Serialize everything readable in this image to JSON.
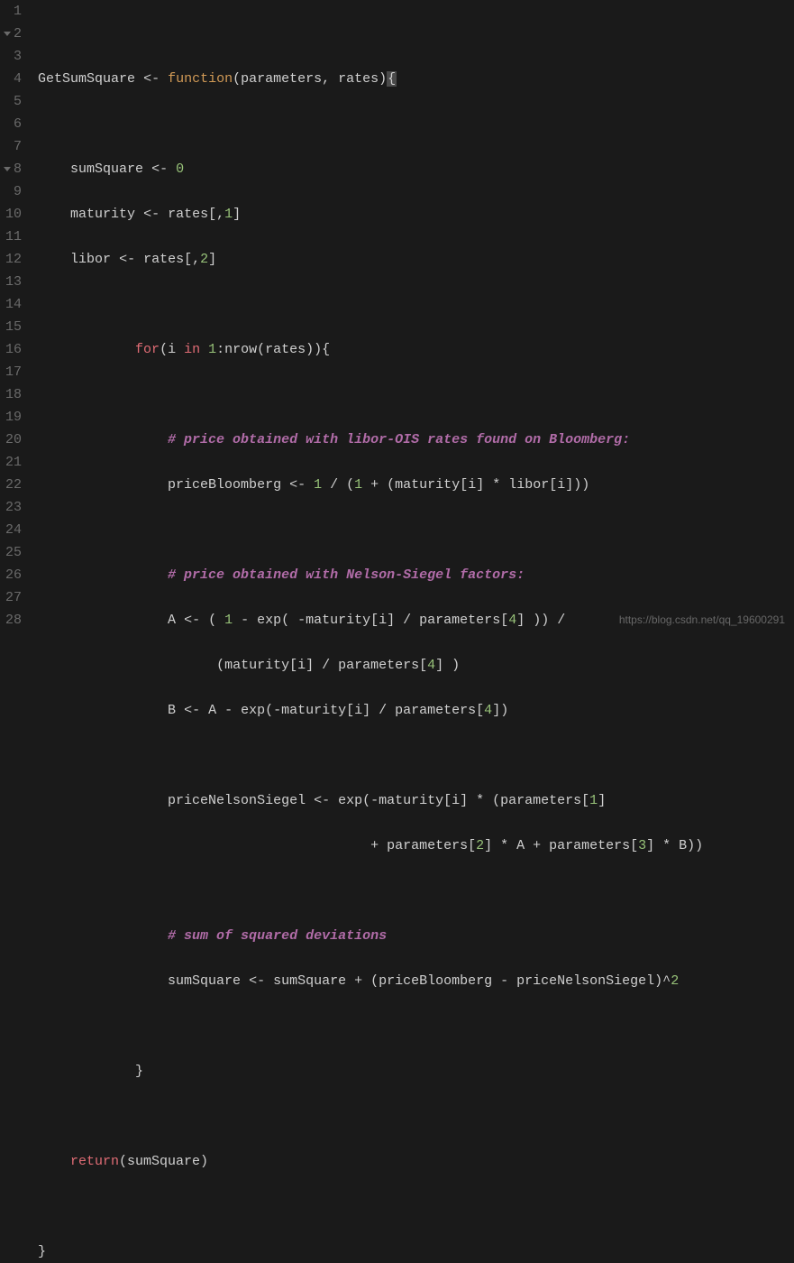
{
  "editor": {
    "watermark": "https://blog.csdn.net/qq_19600291",
    "lines": [
      {
        "num": "1",
        "fold": false
      },
      {
        "num": "2",
        "fold": true
      },
      {
        "num": "3",
        "fold": false
      },
      {
        "num": "4",
        "fold": false
      },
      {
        "num": "5",
        "fold": false
      },
      {
        "num": "6",
        "fold": false
      },
      {
        "num": "7",
        "fold": false
      },
      {
        "num": "8",
        "fold": true
      },
      {
        "num": "9",
        "fold": false
      },
      {
        "num": "10",
        "fold": false
      },
      {
        "num": "11",
        "fold": false
      },
      {
        "num": "12",
        "fold": false
      },
      {
        "num": "13",
        "fold": false
      },
      {
        "num": "14",
        "fold": false
      },
      {
        "num": "15",
        "fold": false
      },
      {
        "num": "16",
        "fold": false
      },
      {
        "num": "17",
        "fold": false
      },
      {
        "num": "18",
        "fold": false
      },
      {
        "num": "19",
        "fold": false
      },
      {
        "num": "20",
        "fold": false
      },
      {
        "num": "21",
        "fold": false
      },
      {
        "num": "22",
        "fold": false
      },
      {
        "num": "23",
        "fold": false
      },
      {
        "num": "24",
        "fold": false
      },
      {
        "num": "25",
        "fold": false
      },
      {
        "num": "26",
        "fold": false
      },
      {
        "num": "27",
        "fold": false
      },
      {
        "num": "28",
        "fold": false
      }
    ],
    "code": {
      "l1": "",
      "l2": {
        "name": "GetSumSquare",
        "assign": "<-",
        "fn": "function",
        "params": "(parameters, rates)",
        "brace": "{"
      },
      "l3": "",
      "l4": {
        "var": "sumSquare",
        "assign": "<-",
        "val": "0"
      },
      "l5": {
        "var": "maturity",
        "assign": "<-",
        "expr1": "rates[,",
        "num": "1",
        "expr2": "]"
      },
      "l6": {
        "var": "libor",
        "assign": "<-",
        "expr1": "rates[,",
        "num": "2",
        "expr2": "]"
      },
      "l7": "",
      "l8": {
        "kw": "for",
        "p1": "(i ",
        "in": "in",
        "sp": " ",
        "num": "1",
        "p2": ":nrow(rates)){"
      },
      "l9": "",
      "l10": {
        "comment": "# price obtained with libor-OIS rates found on Bloomberg:"
      },
      "l11": {
        "var": "priceBloomberg",
        "assign": "<-",
        "n1": "1",
        "t1": " / (",
        "n2": "1",
        "t2": " + (maturity[i] * libor[i]))"
      },
      "l12": "",
      "l13": {
        "comment": "# price obtained with Nelson-Siegel factors:"
      },
      "l14": {
        "var": "A",
        "assign": "<-",
        "t1": "( ",
        "n1": "1",
        "t2": " - exp( -maturity[i] / parameters[",
        "n2": "4",
        "t3": "] )) /"
      },
      "l15": {
        "t1": "(maturity[i] / parameters[",
        "n1": "4",
        "t2": "] )"
      },
      "l16": {
        "var": "B",
        "assign": "<-",
        "t1": "A - exp(-maturity[i] / parameters[",
        "n1": "4",
        "t2": "])"
      },
      "l17": "",
      "l18": {
        "var": "priceNelsonSiegel",
        "assign": "<-",
        "t1": "exp(-maturity[i] * (parameters[",
        "n1": "1",
        "t2": "]"
      },
      "l19": {
        "t1": "+ parameters[",
        "n1": "2",
        "t2": "] * A + parameters[",
        "n2": "3",
        "t3": "] * B))"
      },
      "l20": "",
      "l21": {
        "comment": "# sum of squared deviations"
      },
      "l22": {
        "var": "sumSquare",
        "assign": "<-",
        "t1": "sumSquare + (priceBloomberg - priceNelsonSiegel)^",
        "n1": "2"
      },
      "l23": "",
      "l24": {
        "brace": "}"
      },
      "l25": "",
      "l26": {
        "kw": "return",
        "t1": "(sumSquare)"
      },
      "l27": "",
      "l28": {
        "brace": "}"
      }
    }
  }
}
